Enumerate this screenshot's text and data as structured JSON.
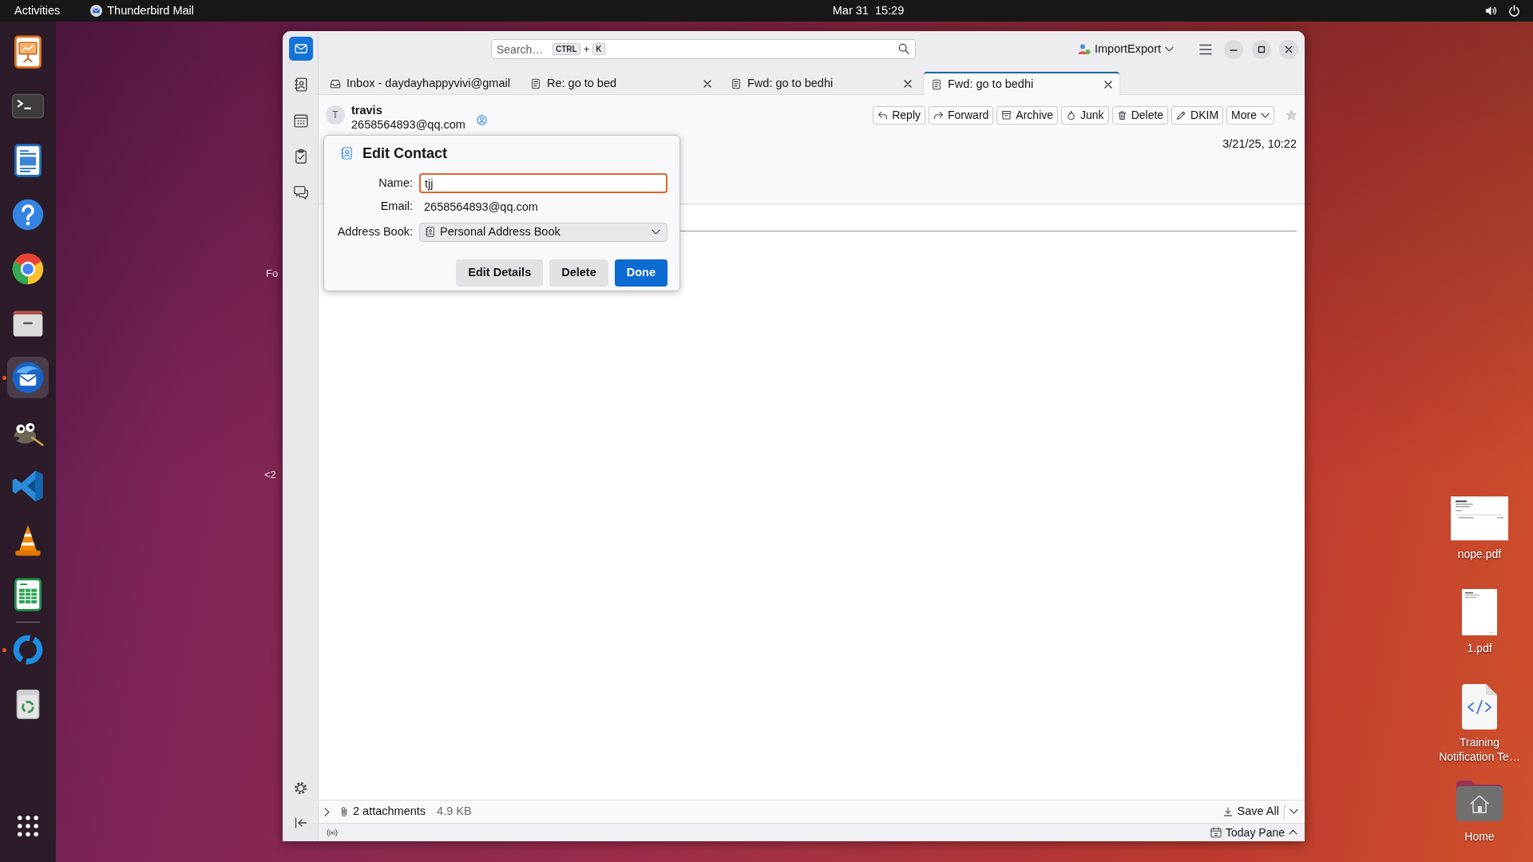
{
  "top_bar": {
    "activities": "Activities",
    "app_name": "Thunderbird Mail",
    "clock": "Mar 31  15:29"
  },
  "dock": {
    "items": [
      {
        "kind": "presentation",
        "running": false,
        "selected": false
      },
      {
        "kind": "terminal",
        "running": false,
        "selected": false
      },
      {
        "kind": "document",
        "running": false,
        "selected": false
      },
      {
        "kind": "help",
        "running": false,
        "selected": false
      },
      {
        "kind": "browser",
        "running": false,
        "selected": false
      },
      {
        "kind": "files",
        "running": false,
        "selected": false
      },
      {
        "kind": "mail",
        "running": true,
        "selected": true
      },
      {
        "kind": "image-editor",
        "running": false,
        "selected": false
      },
      {
        "kind": "code-editor",
        "running": false,
        "selected": false
      },
      {
        "kind": "media-player",
        "running": false,
        "selected": false
      },
      {
        "kind": "spreadsheet",
        "running": false,
        "selected": false
      }
    ],
    "more_items": [
      {
        "kind": "sync",
        "running": true,
        "selected": false
      },
      {
        "kind": "trash",
        "running": false,
        "selected": false
      }
    ]
  },
  "background_fragments": [
    "Fo",
    "<2"
  ],
  "desktop_icons": [
    {
      "label": "nope.pdf",
      "kind": "pdf-landscape"
    },
    {
      "label": "1.pdf",
      "kind": "pdf"
    },
    {
      "label": "Training Notification Te…",
      "kind": "code-file"
    },
    {
      "label": "Home",
      "kind": "home"
    }
  ],
  "window": {
    "spaces": [
      {
        "kind": "mail",
        "selected": true
      },
      {
        "kind": "address-book",
        "selected": false
      },
      {
        "kind": "calendar",
        "selected": false
      },
      {
        "kind": "tasks",
        "selected": false
      },
      {
        "kind": "chat",
        "selected": false
      }
    ],
    "search": {
      "placeholder": "Search…",
      "shortcut": [
        "CTRL",
        "K"
      ],
      "shortcut_joiner": "+"
    },
    "account": "ImportExport",
    "tabs": [
      {
        "title": "Inbox - daydayhappyvivi@gmail",
        "kind": "folder",
        "selected": false,
        "closable": false
      },
      {
        "title": "Re: go to bed",
        "kind": "message",
        "selected": false,
        "closable": true
      },
      {
        "title": "Fwd: go to bedhi",
        "kind": "message",
        "selected": false,
        "closable": true
      },
      {
        "title": "Fwd: go to bedhi",
        "kind": "message",
        "selected": true,
        "closable": true
      }
    ],
    "message": {
      "sender": {
        "initial": "T",
        "name": "travis",
        "email": "2658564893@qq.com",
        "in_address_book": true
      },
      "actions": [
        {
          "label": "Reply",
          "kind": "reply"
        },
        {
          "label": "Forward",
          "kind": "forward"
        },
        {
          "label": "Archive",
          "kind": "archive"
        },
        {
          "label": "Junk",
          "kind": "junk"
        },
        {
          "label": "Delete",
          "kind": "delete"
        },
        {
          "label": "DKIM",
          "kind": "dkim"
        },
        {
          "label": "More",
          "kind": "more"
        }
      ],
      "starred": false,
      "date": "3/21/25, 10:22"
    },
    "edit_contact": {
      "title": "Edit Contact",
      "name_label": "Name:",
      "name_value": "tjj",
      "name_focused": true,
      "email_label": "Email:",
      "email_value": "2658564893@qq.com",
      "book_label": "Address Book:",
      "book_value": "Personal Address Book",
      "buttons": [
        {
          "label": "Edit Details",
          "kind": "secondary"
        },
        {
          "label": "Delete",
          "kind": "secondary"
        },
        {
          "label": "Done",
          "kind": "primary"
        }
      ]
    },
    "attachments": {
      "expanded": false,
      "count": "2 attachments",
      "size": "4.9 KB",
      "save_all": "Save All"
    },
    "status_bar": {
      "today_pane": "Today Pane"
    }
  }
}
